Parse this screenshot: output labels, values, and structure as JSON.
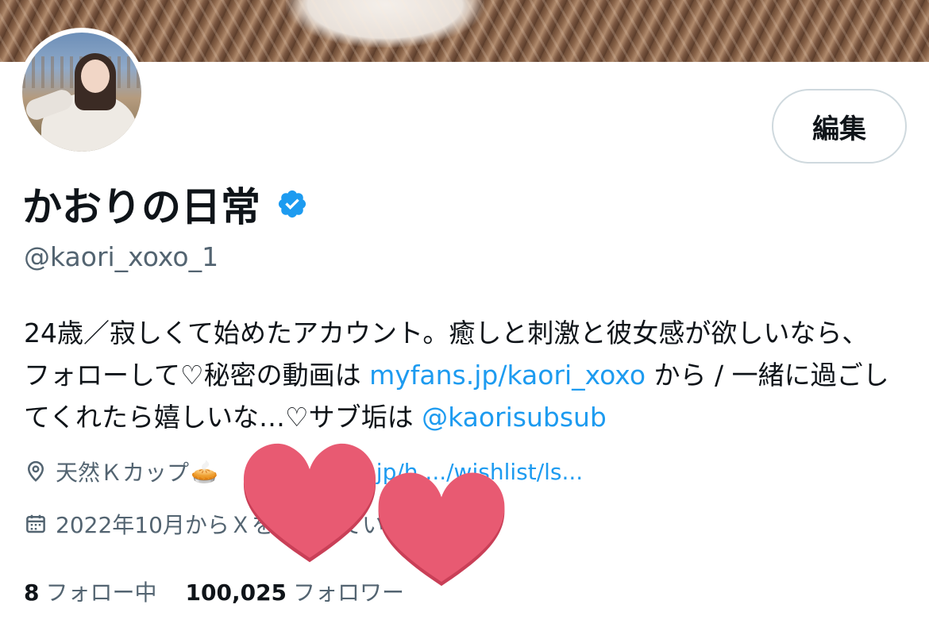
{
  "profile": {
    "edit_label": "編集",
    "display_name": "かおりの日常",
    "handle": "@kaori_xoxo_1",
    "bio": {
      "line1": "24歳／寂しくて始めたアカウント。癒しと刺激と彼女感が欲しいなら、",
      "line2_prefix": "フォローして♡秘密の動画は ",
      "line2_link": "myfans.jp/kaori_xoxo",
      "line2_suffix": " から / 一緒に過ごし",
      "line3_prefix": "てくれたら嬉しいな…♡サブ垢は ",
      "line3_link": "@kaorisubsub"
    },
    "location": "天然Ｋカップ",
    "location_emoji": "🥧",
    "website": ".jp/h..../wishlist/ls...",
    "joined": "2022年10月からＸを利用しています",
    "following_count": "8",
    "following_label": "フォロー中",
    "followers_count": "100,025",
    "followers_label": "フォロワー"
  },
  "colors": {
    "link": "#1d9bf0",
    "secondary_text": "#536471",
    "verified": "#1d9bf0",
    "heart_sticker": "#e85a72"
  },
  "icons": {
    "verified": "verified-badge-icon",
    "location": "location-pin-icon",
    "calendar": "calendar-icon",
    "stickers": "heart-sticker"
  }
}
